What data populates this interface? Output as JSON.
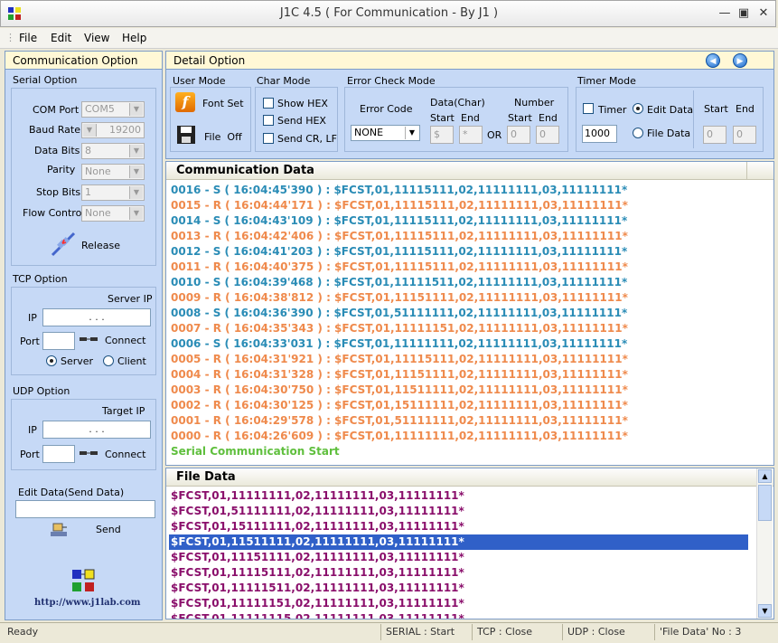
{
  "window": {
    "title": "J1C 4.5 ( For Communication - By J1 )"
  },
  "menu": [
    "File",
    "Edit",
    "View",
    "Help"
  ],
  "left": {
    "header": "Communication Option",
    "serial": {
      "title": "Serial Option",
      "com_port_label": "COM Port",
      "com_port": "COM5",
      "baud_label": "Baud Rate",
      "baud": "19200",
      "data_bits_label": "Data Bits",
      "data_bits": "8",
      "parity_label": "Parity",
      "parity": "None",
      "stop_bits_label": "Stop Bits",
      "stop_bits": "1",
      "flow_label": "Flow Control",
      "flow": "None",
      "release_label": "Release"
    },
    "tcp": {
      "title": "TCP Option",
      "server_ip_label": "Server IP",
      "ip_label": "IP",
      "ip_dots": ".    .    .",
      "port_label": "Port",
      "connect_label": "Connect",
      "server_label": "Server",
      "client_label": "Client"
    },
    "udp": {
      "title": "UDP Option",
      "target_ip_label": "Target IP",
      "ip_label": "IP",
      "ip_dots": ".    .    .",
      "port_label": "Port",
      "connect_label": "Connect"
    },
    "edit": {
      "label": "Edit Data(Send Data)",
      "value": "",
      "send_label": "Send"
    },
    "logo_url": "http://www.j1lab.com"
  },
  "detail": {
    "header": "Detail Option",
    "user_mode": {
      "title": "User Mode",
      "font_set": "Font Set",
      "file_label": "File",
      "file_state": "Off"
    },
    "char_mode": {
      "title": "Char Mode",
      "show_hex": "Show HEX",
      "send_hex": "Send HEX",
      "send_crlf": "Send CR, LF"
    },
    "error_check": {
      "title": "Error Check Mode",
      "error_code_label": "Error Code",
      "error_code": "NONE",
      "data_char_label": "Data(Char)",
      "number_label": "Number",
      "start": "Start",
      "end": "End",
      "or": "OR",
      "data_start": "$",
      "data_end": "*",
      "num_start": "0",
      "num_end": "0"
    },
    "timer": {
      "title": "Timer Mode",
      "timer_label": "Timer",
      "timer_value": "1000",
      "edit_data": "Edit Data",
      "file_data": "File Data",
      "start": "Start",
      "end": "End",
      "start_value": "0",
      "end_value": "0"
    }
  },
  "comm": {
    "header": "Communication Data",
    "rows": [
      {
        "text": "0016 - S ( 16:04:45'390 ) : $FCST,01,11115111,02,11111111,03,11111111*",
        "type": "S"
      },
      {
        "text": "0015 - R ( 16:04:44'171 ) : $FCST,01,11115111,02,11111111,03,11111111*",
        "type": "R"
      },
      {
        "text": "0014 - S ( 16:04:43'109 ) : $FCST,01,11115111,02,11111111,03,11111111*",
        "type": "S"
      },
      {
        "text": "0013 - R ( 16:04:42'406 ) : $FCST,01,11115111,02,11111111,03,11111111*",
        "type": "R"
      },
      {
        "text": "0012 - S ( 16:04:41'203 ) : $FCST,01,11115111,02,11111111,03,11111111*",
        "type": "S"
      },
      {
        "text": "0011 - R ( 16:04:40'375 ) : $FCST,01,11115111,02,11111111,03,11111111*",
        "type": "R"
      },
      {
        "text": "0010 - S ( 16:04:39'468 ) : $FCST,01,11111511,02,11111111,03,11111111*",
        "type": "S"
      },
      {
        "text": "0009 - R ( 16:04:38'812 ) : $FCST,01,11151111,02,11111111,03,11111111*",
        "type": "R"
      },
      {
        "text": "0008 - S ( 16:04:36'390 ) : $FCST,01,51111111,02,11111111,03,11111111*",
        "type": "S"
      },
      {
        "text": "0007 - R ( 16:04:35'343 ) : $FCST,01,11111151,02,11111111,03,11111111*",
        "type": "R"
      },
      {
        "text": "0006 - S ( 16:04:33'031 ) : $FCST,01,11111111,02,11111111,03,11111111*",
        "type": "S"
      },
      {
        "text": "0005 - R ( 16:04:31'921 ) : $FCST,01,11115111,02,11111111,03,11111111*",
        "type": "R"
      },
      {
        "text": "0004 - R ( 16:04:31'328 ) : $FCST,01,11151111,02,11111111,03,11111111*",
        "type": "R"
      },
      {
        "text": "0003 - R ( 16:04:30'750 ) : $FCST,01,11511111,02,11111111,03,11111111*",
        "type": "R"
      },
      {
        "text": "0002 - R ( 16:04:30'125 ) : $FCST,01,15111111,02,11111111,03,11111111*",
        "type": "R"
      },
      {
        "text": "0001 - R ( 16:04:29'578 ) : $FCST,01,51111111,02,11111111,03,11111111*",
        "type": "R"
      },
      {
        "text": "0000 - R ( 16:04:26'609 ) : $FCST,01,11111111,02,11111111,03,11111111*",
        "type": "R"
      },
      {
        "text": "Serial Communication Start",
        "type": "G"
      }
    ]
  },
  "file": {
    "header": "File Data",
    "rows": [
      {
        "text": "$FCST,01,11111111,02,11111111,03,11111111*",
        "selected": false
      },
      {
        "text": "$FCST,01,51111111,02,11111111,03,11111111*",
        "selected": false
      },
      {
        "text": "$FCST,01,15111111,02,11111111,03,11111111*",
        "selected": false
      },
      {
        "text": "$FCST,01,11511111,02,11111111,03,11111111*",
        "selected": true
      },
      {
        "text": "$FCST,01,11151111,02,11111111,03,11111111*",
        "selected": false
      },
      {
        "text": "$FCST,01,11115111,02,11111111,03,11111111*",
        "selected": false
      },
      {
        "text": "$FCST,01,11111511,02,11111111,03,11111111*",
        "selected": false
      },
      {
        "text": "$FCST,01,11111151,02,11111111,03,11111111*",
        "selected": false
      },
      {
        "text": "$FCST,01,11111115,02,11111111,03,11111111*",
        "selected": false
      }
    ]
  },
  "status": {
    "ready": "Ready",
    "serial": "SERIAL : Start",
    "tcp": "TCP : Close",
    "udp": "UDP : Close",
    "file_no": "'File Data' No : 3"
  },
  "colors": {
    "send": "#2a8cb6",
    "receive": "#ef8a4c",
    "start": "#5fbf3d",
    "file": "#8a0f6b",
    "selection": "#3060c8"
  }
}
